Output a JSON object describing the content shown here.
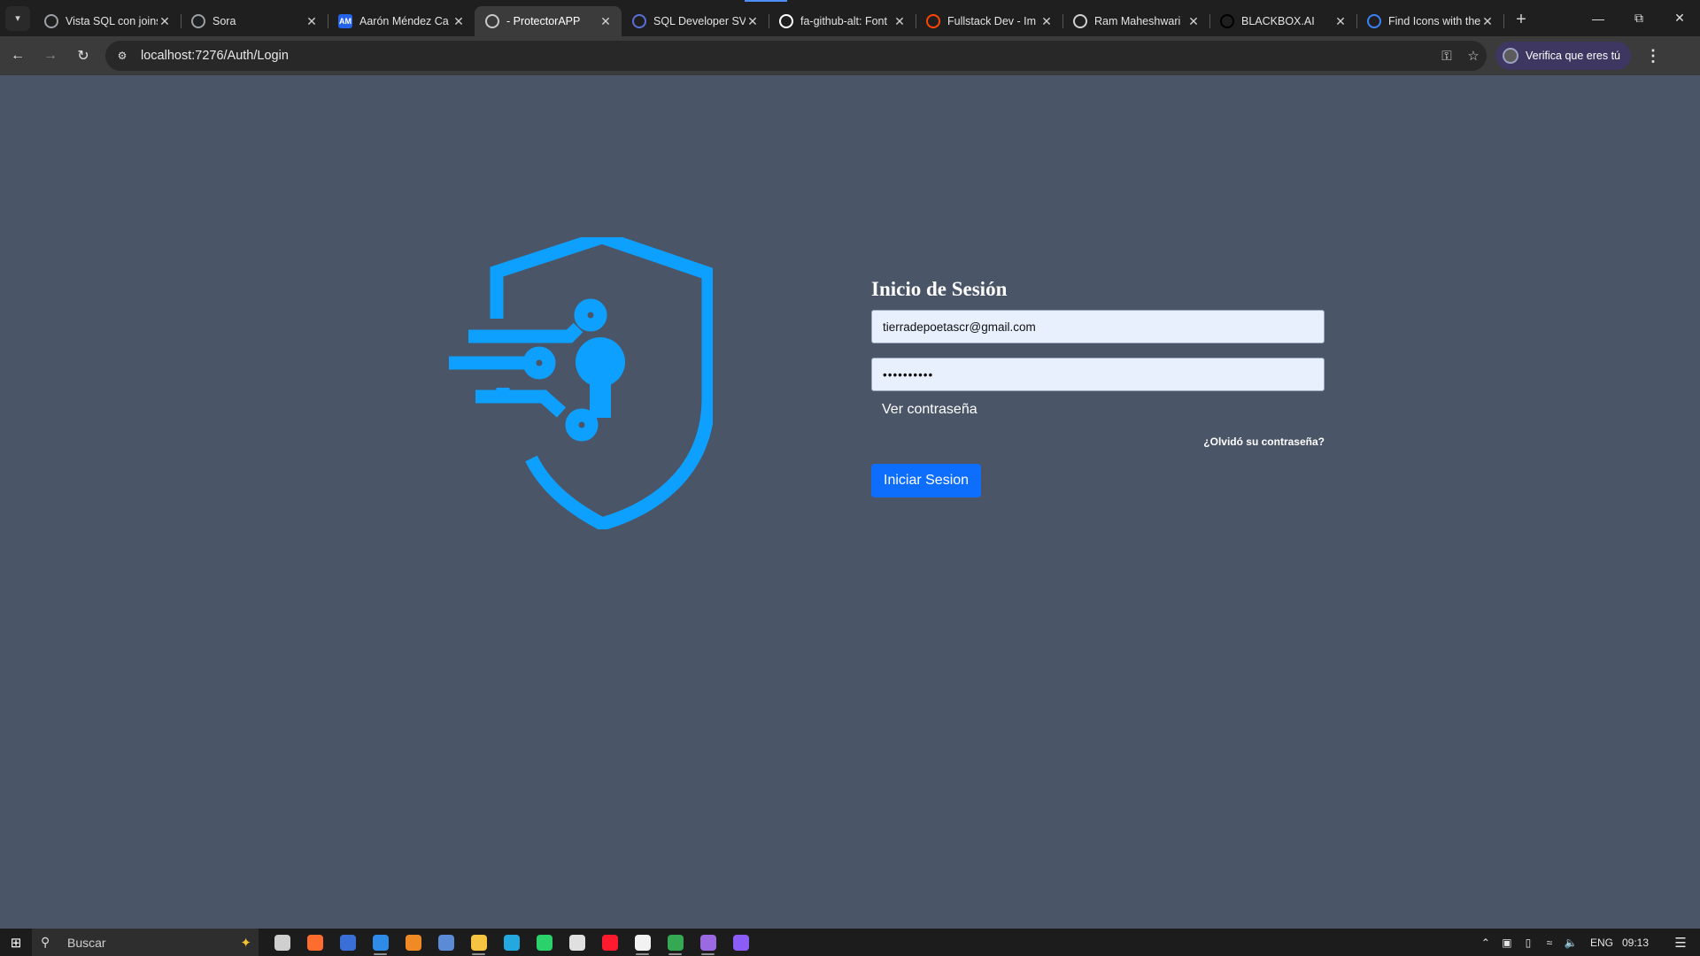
{
  "browser": {
    "tab_search_icon": "chevron-down-icon",
    "tabs": [
      {
        "title": "Vista SQL con joins",
        "favicon": "gear-icon",
        "favicon_color": "#9aa0a6",
        "active": false
      },
      {
        "title": "Sora",
        "favicon": "play-icon",
        "favicon_color": "#9aa0a6",
        "active": false
      },
      {
        "title": "Aarón Méndez Ca",
        "favicon": "AM",
        "favicon_color": "#2563eb",
        "active": false
      },
      {
        "title": "- ProtectorAPP",
        "favicon": "document-icon",
        "favicon_color": "#c8c8c8",
        "active": true
      },
      {
        "title": "SQL Developer SV",
        "favicon": "sql-icon",
        "favicon_color": "#5b6fd6",
        "active": false
      },
      {
        "title": "fa-github-alt: Font",
        "favicon": "flag-icon",
        "favicon_color": "#ffffff",
        "active": false
      },
      {
        "title": "Fullstack Dev - Im",
        "favicon": "reddit-icon",
        "favicon_color": "#ff4500",
        "active": false
      },
      {
        "title": "Ram Maheshwari",
        "favicon": "person-icon",
        "favicon_color": "#d0d0d0",
        "active": false
      },
      {
        "title": "BLACKBOX.AI",
        "favicon": "blackbox-icon",
        "favicon_color": "#000000",
        "active": false
      },
      {
        "title": "Find Icons with the",
        "favicon": "flag-icon",
        "favicon_color": "#3b82f6",
        "active": false
      }
    ],
    "close_glyph": "✕",
    "new_tab_glyph": "+",
    "url": "localhost:7276/Auth/Login",
    "profile_label": "Verifica que eres tú"
  },
  "page": {
    "heading": "Inicio de Sesión",
    "email_value": "tierradepoetascr@gmail.com",
    "password_value": "••••••••••",
    "show_password": "Ver contraseña",
    "forgot_password": "¿Olvidó su contraseña?",
    "submit_label": "Iniciar Sesion",
    "logo_color": "#0ea0ff"
  },
  "taskbar": {
    "search_label": "Buscar",
    "apps": [
      {
        "name": "task-view",
        "color": "#cfcfcf",
        "open": false
      },
      {
        "name": "firefox-dev",
        "color": "#ff6d2e",
        "open": false
      },
      {
        "name": "intellij",
        "color": "#3a6fd8",
        "open": false
      },
      {
        "name": "vscode",
        "color": "#2e8ce8",
        "open": true
      },
      {
        "name": "sublime",
        "color": "#f08a24",
        "open": false
      },
      {
        "name": "ssms",
        "color": "#5b8ad6",
        "open": false
      },
      {
        "name": "file-explorer",
        "color": "#f5c542",
        "open": true
      },
      {
        "name": "edge",
        "color": "#23a8e0",
        "open": false
      },
      {
        "name": "whatsapp",
        "color": "#2bd16b",
        "open": false
      },
      {
        "name": "rider",
        "color": "#e0e0e0",
        "open": false
      },
      {
        "name": "opera",
        "color": "#ff1b2d",
        "open": false
      },
      {
        "name": "notion",
        "color": "#f2f2f2",
        "open": true
      },
      {
        "name": "chrome",
        "color": "#34a853",
        "open": true
      },
      {
        "name": "visual-studio",
        "color": "#9b6ae3",
        "open": true
      },
      {
        "name": "code-editor",
        "color": "#8b5cf6",
        "open": false
      }
    ],
    "language": "ENG",
    "time": "09:13"
  }
}
